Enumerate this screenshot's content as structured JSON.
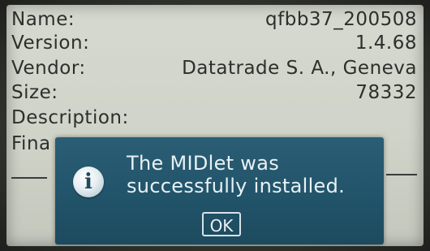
{
  "details": {
    "name_label": "Name:",
    "name_value": "qfbb37_200508",
    "version_label": "Version:",
    "version_value": "1.4.68",
    "vendor_label": "Vendor:",
    "vendor_value": "Datatrade S. A., Geneva",
    "size_label": "Size:",
    "size_value": "78332",
    "description_label": "Description:",
    "final_label_partial": "Fina"
  },
  "dialog": {
    "icon": "info-icon",
    "message_line1": "The MIDlet was",
    "message_line2": "successfully installed.",
    "ok_label": "OK"
  },
  "colors": {
    "screen_bg": "#d3d6cc",
    "text": "#2c2f2b",
    "dialog_bg": "#22556b",
    "dialog_text": "#e9f1f4"
  }
}
